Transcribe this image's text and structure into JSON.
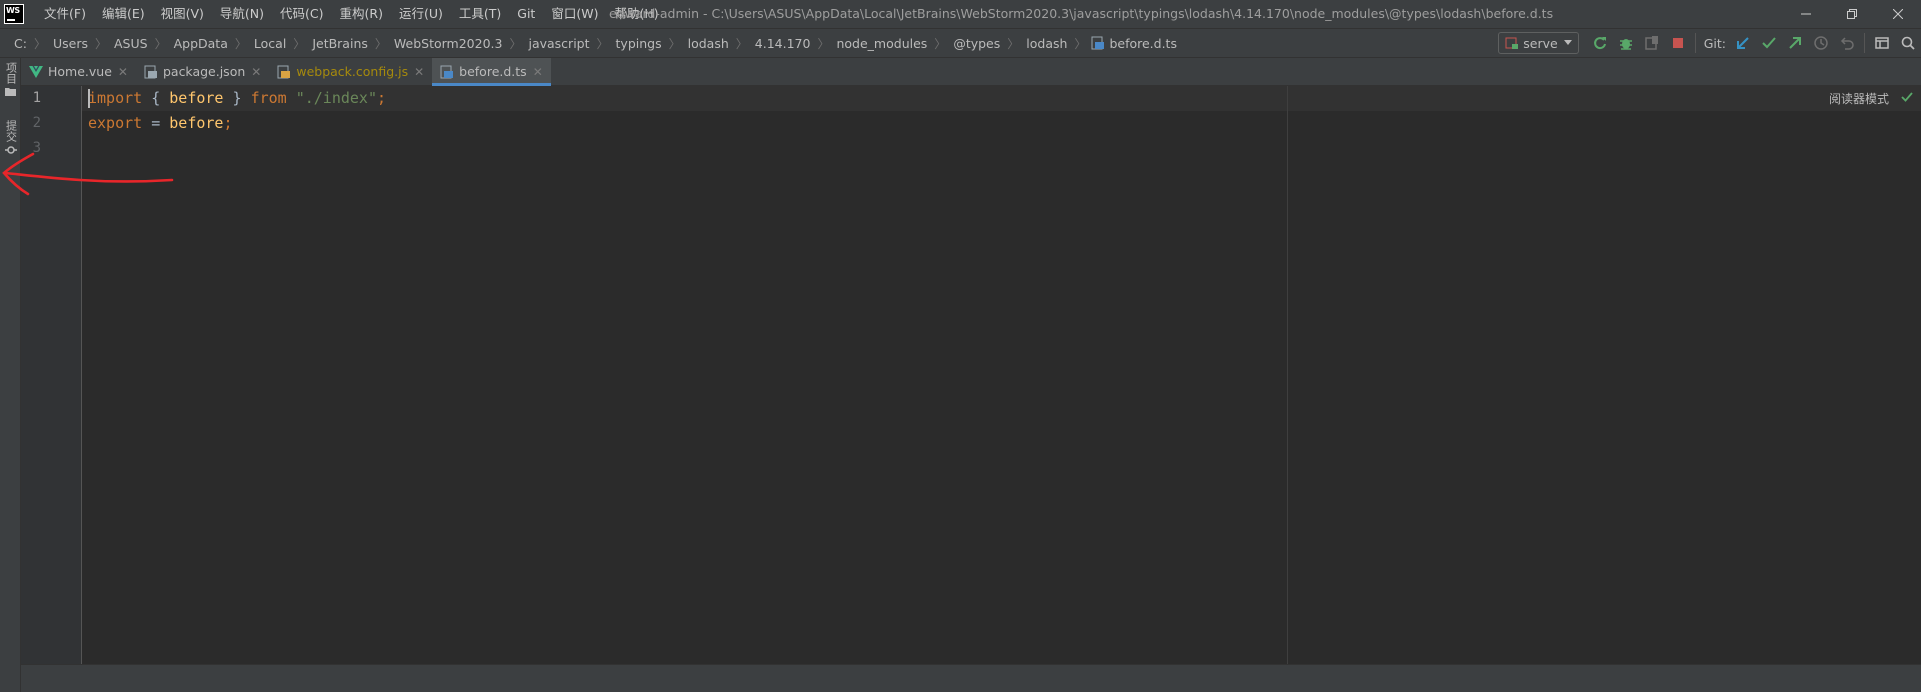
{
  "app": {
    "logo_text": "WS",
    "window_title": "edward-admin - C:\\Users\\ASUS\\AppData\\Local\\JetBrains\\WebStorm2020.3\\javascript\\typings\\lodash\\4.14.170\\node_modules\\@types\\lodash\\before.d.ts"
  },
  "menu": [
    {
      "label": "文件(F)"
    },
    {
      "label": "编辑(E)"
    },
    {
      "label": "视图(V)"
    },
    {
      "label": "导航(N)"
    },
    {
      "label": "代码(C)"
    },
    {
      "label": "重构(R)"
    },
    {
      "label": "运行(U)"
    },
    {
      "label": "工具(T)"
    },
    {
      "label": "Git"
    },
    {
      "label": "窗口(W)"
    },
    {
      "label": "帮助(H)"
    }
  ],
  "breadcrumb": [
    "C:",
    "Users",
    "ASUS",
    "AppData",
    "Local",
    "JetBrains",
    "WebStorm2020.3",
    "javascript",
    "typings",
    "lodash",
    "4.14.170",
    "node_modules",
    "@types",
    "lodash",
    "before.d.ts"
  ],
  "toolbar": {
    "run_config": "serve",
    "git_label": "Git:"
  },
  "tool_strip": {
    "project": "项目",
    "commit": "提交"
  },
  "tabs": [
    {
      "label": "Home.vue",
      "icon": "vue-icon",
      "active": false,
      "modified": false
    },
    {
      "label": "package.json",
      "icon": "json-file-icon",
      "active": false,
      "modified": false
    },
    {
      "label": "webpack.config.js",
      "icon": "js-file-icon",
      "active": false,
      "modified": true
    },
    {
      "label": "before.d.ts",
      "icon": "ts-file-icon",
      "active": true,
      "modified": false
    }
  ],
  "editor": {
    "line_numbers": [
      "1",
      "2",
      "3"
    ],
    "lines": [
      [
        {
          "t": "import",
          "c": "kw"
        },
        {
          "t": " { ",
          "c": ""
        },
        {
          "t": "before",
          "c": "ident"
        },
        {
          "t": " } ",
          "c": ""
        },
        {
          "t": "from",
          "c": "kw"
        },
        {
          "t": " ",
          "c": ""
        },
        {
          "t": "\"./index\"",
          "c": "str"
        },
        {
          "t": ";",
          "c": "kw"
        }
      ],
      [
        {
          "t": "export",
          "c": "kw"
        },
        {
          "t": " = ",
          "c": ""
        },
        {
          "t": "before",
          "c": "ident"
        },
        {
          "t": ";",
          "c": "kw"
        }
      ],
      []
    ],
    "reader_mode_label": "阅读器模式"
  },
  "colors": {
    "accent_tab_underline": "#4a88c7",
    "annotation_red": "#e8262a",
    "keyword": "#cc7832",
    "string": "#6a8759"
  }
}
